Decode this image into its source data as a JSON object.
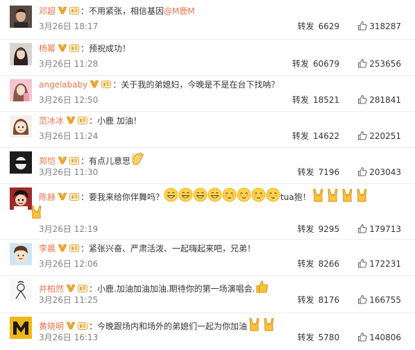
{
  "repost_label": "转发",
  "colors": {
    "username": "#eb7350",
    "mention": "#eb7350",
    "time": "#808080",
    "text": "#333333"
  },
  "comments": [
    {
      "user": "邓超",
      "text": "不用紧张，相信基因",
      "mention": "@M鹿M",
      "emoji_icons": [],
      "text_after": "",
      "date": "3月26日 18:17",
      "reposts": "6629",
      "likes": "318287",
      "avatar": "avatar-man-photo"
    },
    {
      "user": "杨幂",
      "text": "预祝成功！",
      "mention": "",
      "emoji_icons": [],
      "text_after": "",
      "date": "3月26日 11:28",
      "reposts": "60679",
      "likes": "253656",
      "avatar": "avatar-woman-photo"
    },
    {
      "user": "angelababy",
      "text": "关于我的弟媳妇，今晚是不是在台下找呐？",
      "mention": "",
      "emoji_icons": [],
      "text_after": "",
      "date": "3月26日 12:50",
      "reposts": "18521",
      "likes": "281841",
      "avatar": "avatar-pink-photo"
    },
    {
      "user": "范冰冰",
      "text": "小鹿 加油！",
      "mention": "",
      "emoji_icons": [],
      "text_after": "",
      "date": "3月26日 11:24",
      "reposts": "14622",
      "likes": "220251",
      "avatar": "avatar-cartoon-girl"
    },
    {
      "user": "郑恺",
      "text": "有点儿意思",
      "mention": "",
      "emoji_icons": [
        "clap-hand"
      ],
      "text_after": "",
      "date": "3月26日 11:30",
      "reposts": "7196",
      "likes": "203043",
      "avatar": "avatar-sunglasses"
    },
    {
      "user": "陈赫",
      "text": "要我来给你伴舞吗？",
      "mention": "",
      "emoji_icons": [
        "grin",
        "grin",
        "grin",
        "grin",
        "blush",
        "blush",
        "blush",
        "blush"
      ],
      "text_after": "tua狍！",
      "date": "3月26日 12:19",
      "reposts": "9295",
      "likes": "179713",
      "avatar": "avatar-cartoon-man",
      "second_line_icons": [
        "rock-hand",
        "rock-hand",
        "rock-hand",
        "rock-hand",
        "rock-hand"
      ]
    },
    {
      "user": "李晨",
      "text": "紧张兴奋、严肃活泼、一起嗨起来吧，兄弟！",
      "mention": "",
      "emoji_icons": [],
      "text_after": "",
      "date": "3月26日 12:06",
      "reposts": "8266",
      "likes": "172231",
      "avatar": "avatar-cartoon-boy"
    },
    {
      "user": "井柏然",
      "text": "小鹿.加油加油加油.期待你的第一场演唱会.",
      "mention": "",
      "emoji_icons": [
        "thumbs-up"
      ],
      "text_after": "",
      "date": "3月26日 11:25",
      "reposts": "8176",
      "likes": "166755",
      "avatar": "avatar-sketch"
    },
    {
      "user": "黄晓明",
      "text": "今晚跟场内和场外的弟媳们一起为你加油",
      "mention": "",
      "emoji_icons": [
        "rock-hand",
        "rock-hand"
      ],
      "text_after": "",
      "date": "3月26日 16:13",
      "reposts": "5780",
      "likes": "140806",
      "avatar": "avatar-letter-m"
    }
  ]
}
